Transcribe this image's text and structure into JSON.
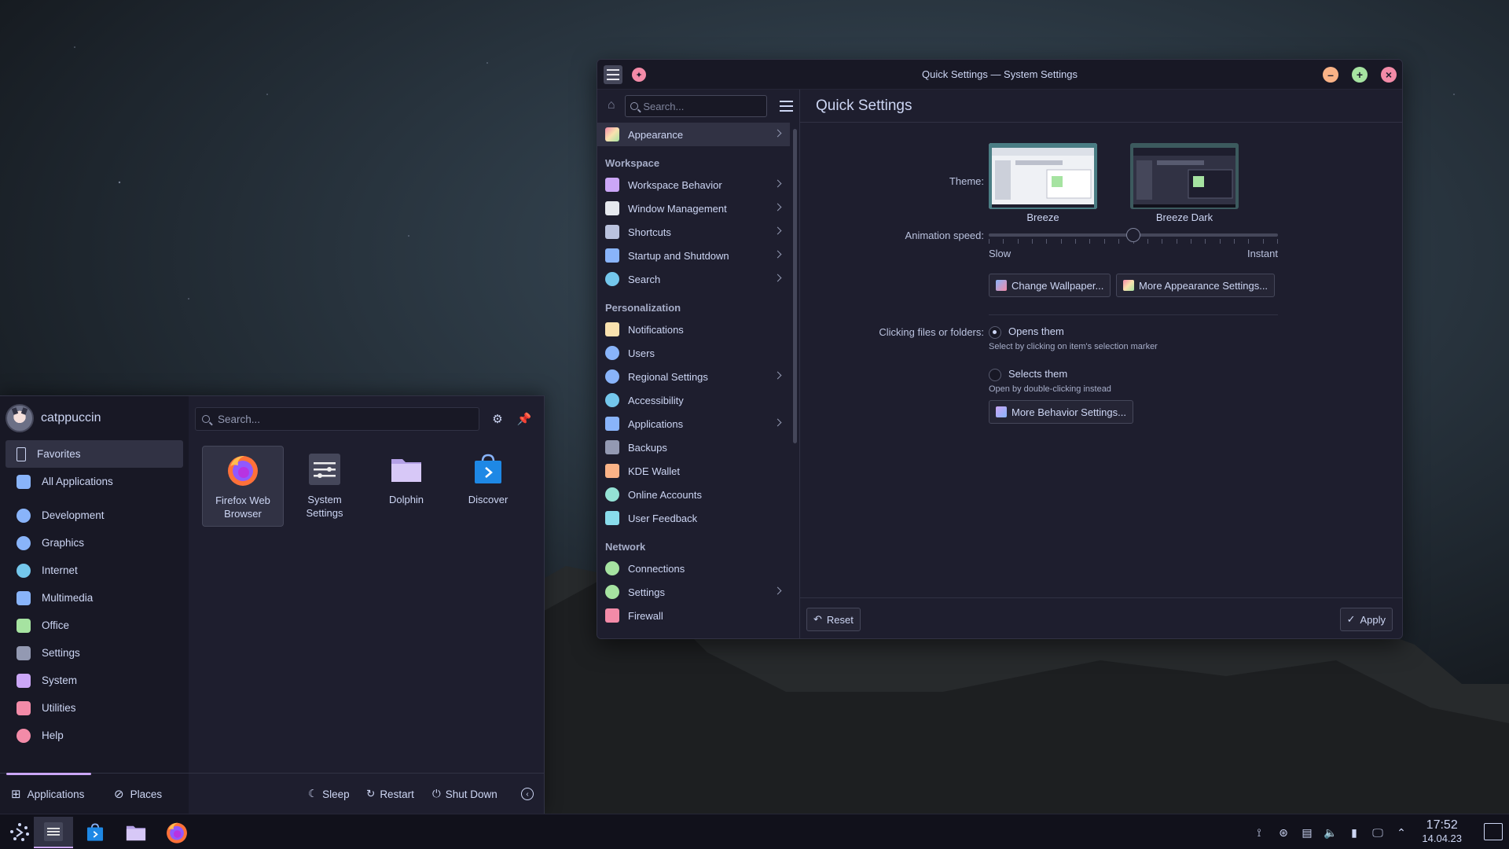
{
  "window": {
    "title": "Quick Settings — System Settings",
    "search_placeholder": "Search...",
    "page_title": "Quick Settings"
  },
  "sidebar": {
    "top_item": {
      "label": "Appearance"
    },
    "sections": [
      {
        "title": "Workspace",
        "items": [
          {
            "label": "Workspace Behavior",
            "chevron": true,
            "color": "#cba6f7"
          },
          {
            "label": "Window Management",
            "chevron": true,
            "color": "#e6e9ef"
          },
          {
            "label": "Shortcuts",
            "chevron": true,
            "color": "#bac2de"
          },
          {
            "label": "Startup and Shutdown",
            "chevron": true,
            "color": "#89b4fa"
          },
          {
            "label": "Search",
            "chevron": true,
            "color": "#74c7ec"
          }
        ]
      },
      {
        "title": "Personalization",
        "items": [
          {
            "label": "Notifications",
            "chevron": false,
            "color": "#f9e2af"
          },
          {
            "label": "Users",
            "chevron": false,
            "color": "#89b4fa"
          },
          {
            "label": "Regional Settings",
            "chevron": true,
            "color": "#89b4fa"
          },
          {
            "label": "Accessibility",
            "chevron": false,
            "color": "#74c7ec"
          },
          {
            "label": "Applications",
            "chevron": true,
            "color": "#89b4fa"
          },
          {
            "label": "Backups",
            "chevron": false,
            "color": "#9399b2"
          },
          {
            "label": "KDE Wallet",
            "chevron": false,
            "color": "#fab387"
          },
          {
            "label": "Online Accounts",
            "chevron": false,
            "color": "#94e2d5"
          },
          {
            "label": "User Feedback",
            "chevron": false,
            "color": "#89dceb"
          }
        ]
      },
      {
        "title": "Network",
        "items": [
          {
            "label": "Connections",
            "chevron": false,
            "color": "#a6e3a1"
          },
          {
            "label": "Settings",
            "chevron": true,
            "color": "#a6e3a1"
          },
          {
            "label": "Firewall",
            "chevron": false,
            "color": "#f38ba8"
          }
        ]
      }
    ]
  },
  "quick": {
    "theme_label": "Theme:",
    "themes": [
      "Breeze",
      "Breeze Dark"
    ],
    "animation_label": "Animation speed:",
    "animation_value": 0.5,
    "slow": "Slow",
    "instant": "Instant",
    "change_wallpaper": "Change Wallpaper...",
    "more_appearance": "More Appearance Settings...",
    "clicking_label": "Clicking files or folders:",
    "opens_them": "Opens them",
    "opens_hint": "Select by clicking on item's selection marker",
    "selects_them": "Selects them",
    "selects_hint": "Open by double-clicking instead",
    "more_behavior": "More Behavior Settings...",
    "reset": "Reset",
    "apply": "Apply"
  },
  "launcher": {
    "username": "catppuccin",
    "search_placeholder": "Search...",
    "categories": [
      {
        "label": "Favorites",
        "color": "#cdd6f4"
      },
      {
        "label": "All Applications",
        "color": "#89b4fa"
      },
      {
        "label": "Development",
        "color": "#89b4fa"
      },
      {
        "label": "Graphics",
        "color": "#89b4fa"
      },
      {
        "label": "Internet",
        "color": "#74c7ec"
      },
      {
        "label": "Multimedia",
        "color": "#89b4fa"
      },
      {
        "label": "Office",
        "color": "#a6e3a1"
      },
      {
        "label": "Settings",
        "color": "#9399b2"
      },
      {
        "label": "System",
        "color": "#cba6f7"
      },
      {
        "label": "Utilities",
        "color": "#f38ba8"
      },
      {
        "label": "Help",
        "color": "#f38ba8"
      }
    ],
    "favorites": [
      {
        "line1": "Firefox Web",
        "line2": "Browser"
      },
      {
        "line1": "System",
        "line2": "Settings"
      },
      {
        "line1": "Dolphin",
        "line2": ""
      },
      {
        "line1": "Discover",
        "line2": ""
      }
    ],
    "tabs": {
      "applications": "Applications",
      "places": "Places"
    },
    "power": {
      "sleep": "Sleep",
      "restart": "Restart",
      "shutdown": "Shut Down"
    }
  },
  "taskbar": {
    "time": "17:52",
    "date": "14.04.23"
  }
}
